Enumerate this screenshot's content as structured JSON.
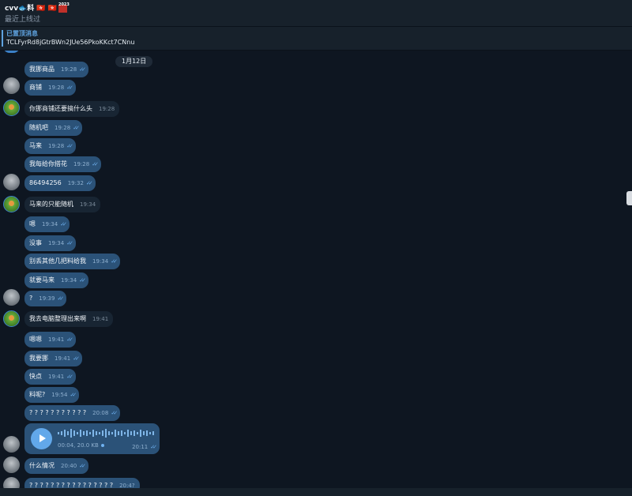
{
  "header": {
    "title": "cvv🐟料 🇭🇰 🇭🇰",
    "title_badge": "2023",
    "subtitle": "最近上线过"
  },
  "pinned": {
    "label": "已置顶消息",
    "text": "TCLFyrRd8jGtrBWn2JUe56PkoKKct7CNnu"
  },
  "date_separator": "1月12日",
  "messages": [
    {
      "text": "我挪商品",
      "time": "19:28",
      "side": "out"
    },
    {
      "text": "商铺",
      "time": "19:28",
      "side": "out"
    },
    {
      "text": "你挪商铺还要搞什么头",
      "time": "19:28",
      "side": "in"
    },
    {
      "text": "随机吧",
      "time": "19:28",
      "side": "out"
    },
    {
      "text": "马来",
      "time": "19:28",
      "side": "out"
    },
    {
      "text": "我每给你搭花",
      "time": "19:28",
      "side": "out"
    },
    {
      "text": "86494256",
      "time": "19:32",
      "side": "out"
    },
    {
      "text": "马来的只能随机",
      "time": "19:34",
      "side": "in"
    },
    {
      "text": "嗯",
      "time": "19:34",
      "side": "out"
    },
    {
      "text": "没事",
      "time": "19:34",
      "side": "out"
    },
    {
      "text": "别丢其他几把料给我",
      "time": "19:34",
      "side": "out"
    },
    {
      "text": "就要马来",
      "time": "19:34",
      "side": "out"
    },
    {
      "text": "?",
      "time": "19:39",
      "side": "out"
    },
    {
      "text": "我去电脑整理出来啊",
      "time": "19:41",
      "side": "in"
    },
    {
      "text": "嗯嗯",
      "time": "19:41",
      "side": "out"
    },
    {
      "text": "我要挪",
      "time": "19:41",
      "side": "out"
    },
    {
      "text": "快点",
      "time": "19:41",
      "side": "out"
    },
    {
      "text": "料呢?",
      "time": "19:54",
      "side": "out"
    },
    {
      "text": "? ? ? ? ? ? ? ? ? ? ?",
      "time": "20:08",
      "side": "out"
    },
    {
      "text": "什么情况",
      "time": "20:40",
      "side": "out"
    },
    {
      "text": "? ? ? ? ? ? ? ? ? ? ? ? ? ? ? ?",
      "time": "20:4?",
      "side": "out"
    }
  ],
  "voice": {
    "duration": "00:04, 20.0 KB",
    "time": "20:11"
  },
  "colors": {
    "background": "#0e1621",
    "outgoing_bubble": "#2b5278",
    "incoming_bubble": "#182533",
    "accent": "#5fa3e0"
  },
  "icons": {
    "ticks": "double-check-icon",
    "play": "play-icon"
  }
}
